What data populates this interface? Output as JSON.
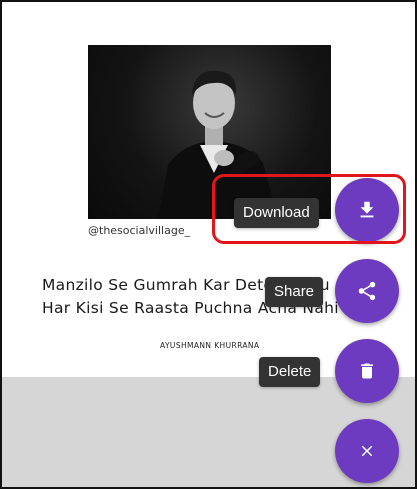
{
  "card": {
    "watermark": "@thesocialvillage_",
    "quote_line1": "Manzilo Se Gumrah Kar Dete Hai Ku",
    "quote_line2": "Har Kisi Se Raasta Puchna Acha Nahi H",
    "author": "AYUSHMANN KHURRANA"
  },
  "fab_menu": {
    "download_label": "Download",
    "share_label": "Share",
    "delete_label": "Delete",
    "download_icon": "download-icon",
    "share_icon": "share-icon",
    "delete_icon": "trash-icon",
    "close_icon": "close-icon"
  },
  "colors": {
    "fab": "#6d3bbf",
    "tooltip": "#333333",
    "highlight": "#e0161c",
    "scrim": "#d6d6d6"
  }
}
